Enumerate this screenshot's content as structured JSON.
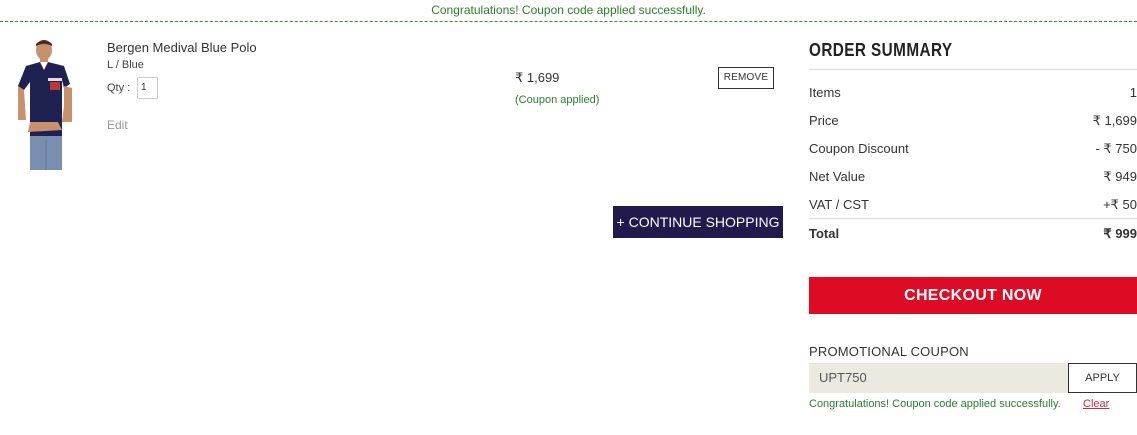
{
  "banner": {
    "message": "Congratulations! Coupon code applied successfully."
  },
  "cart": {
    "item": {
      "name": "Bergen Medival Blue Polo",
      "variant": "L / Blue",
      "qty_label": "Qty :",
      "qty_value": "1",
      "edit_label": "Edit",
      "price": "₹ 1,699",
      "coupon_note": "(Coupon applied)",
      "remove_label": "REMOVE",
      "image_icon": "blue-polo-shirt-photo"
    },
    "continue_label": "+ CONTINUE SHOPPING"
  },
  "summary": {
    "title": "ORDER SUMMARY",
    "rows": [
      {
        "label": "Items",
        "value": "1"
      },
      {
        "label": "Price",
        "value": "₹ 1,699"
      },
      {
        "label": "Coupon Discount",
        "value": "- ₹ 750"
      },
      {
        "label": "Net Value",
        "value": "₹ 949"
      },
      {
        "label": "VAT / CST",
        "value": "+₹ 50"
      }
    ],
    "total": {
      "label": "Total",
      "value": "₹ 999"
    },
    "checkout_label": "CHECKOUT NOW"
  },
  "promo": {
    "label": "PROMOTIONAL COUPON",
    "code": "UPT750",
    "apply_label": "APPLY",
    "message": "Congratulations! Coupon code applied successfully.",
    "clear_label": "Clear"
  },
  "colors": {
    "success_green": "#2e7d2e",
    "checkout_red": "#de0b24",
    "continue_navy": "#221a4c",
    "promo_input_bg": "#ebe9e0",
    "clear_link": "#c2304a"
  }
}
